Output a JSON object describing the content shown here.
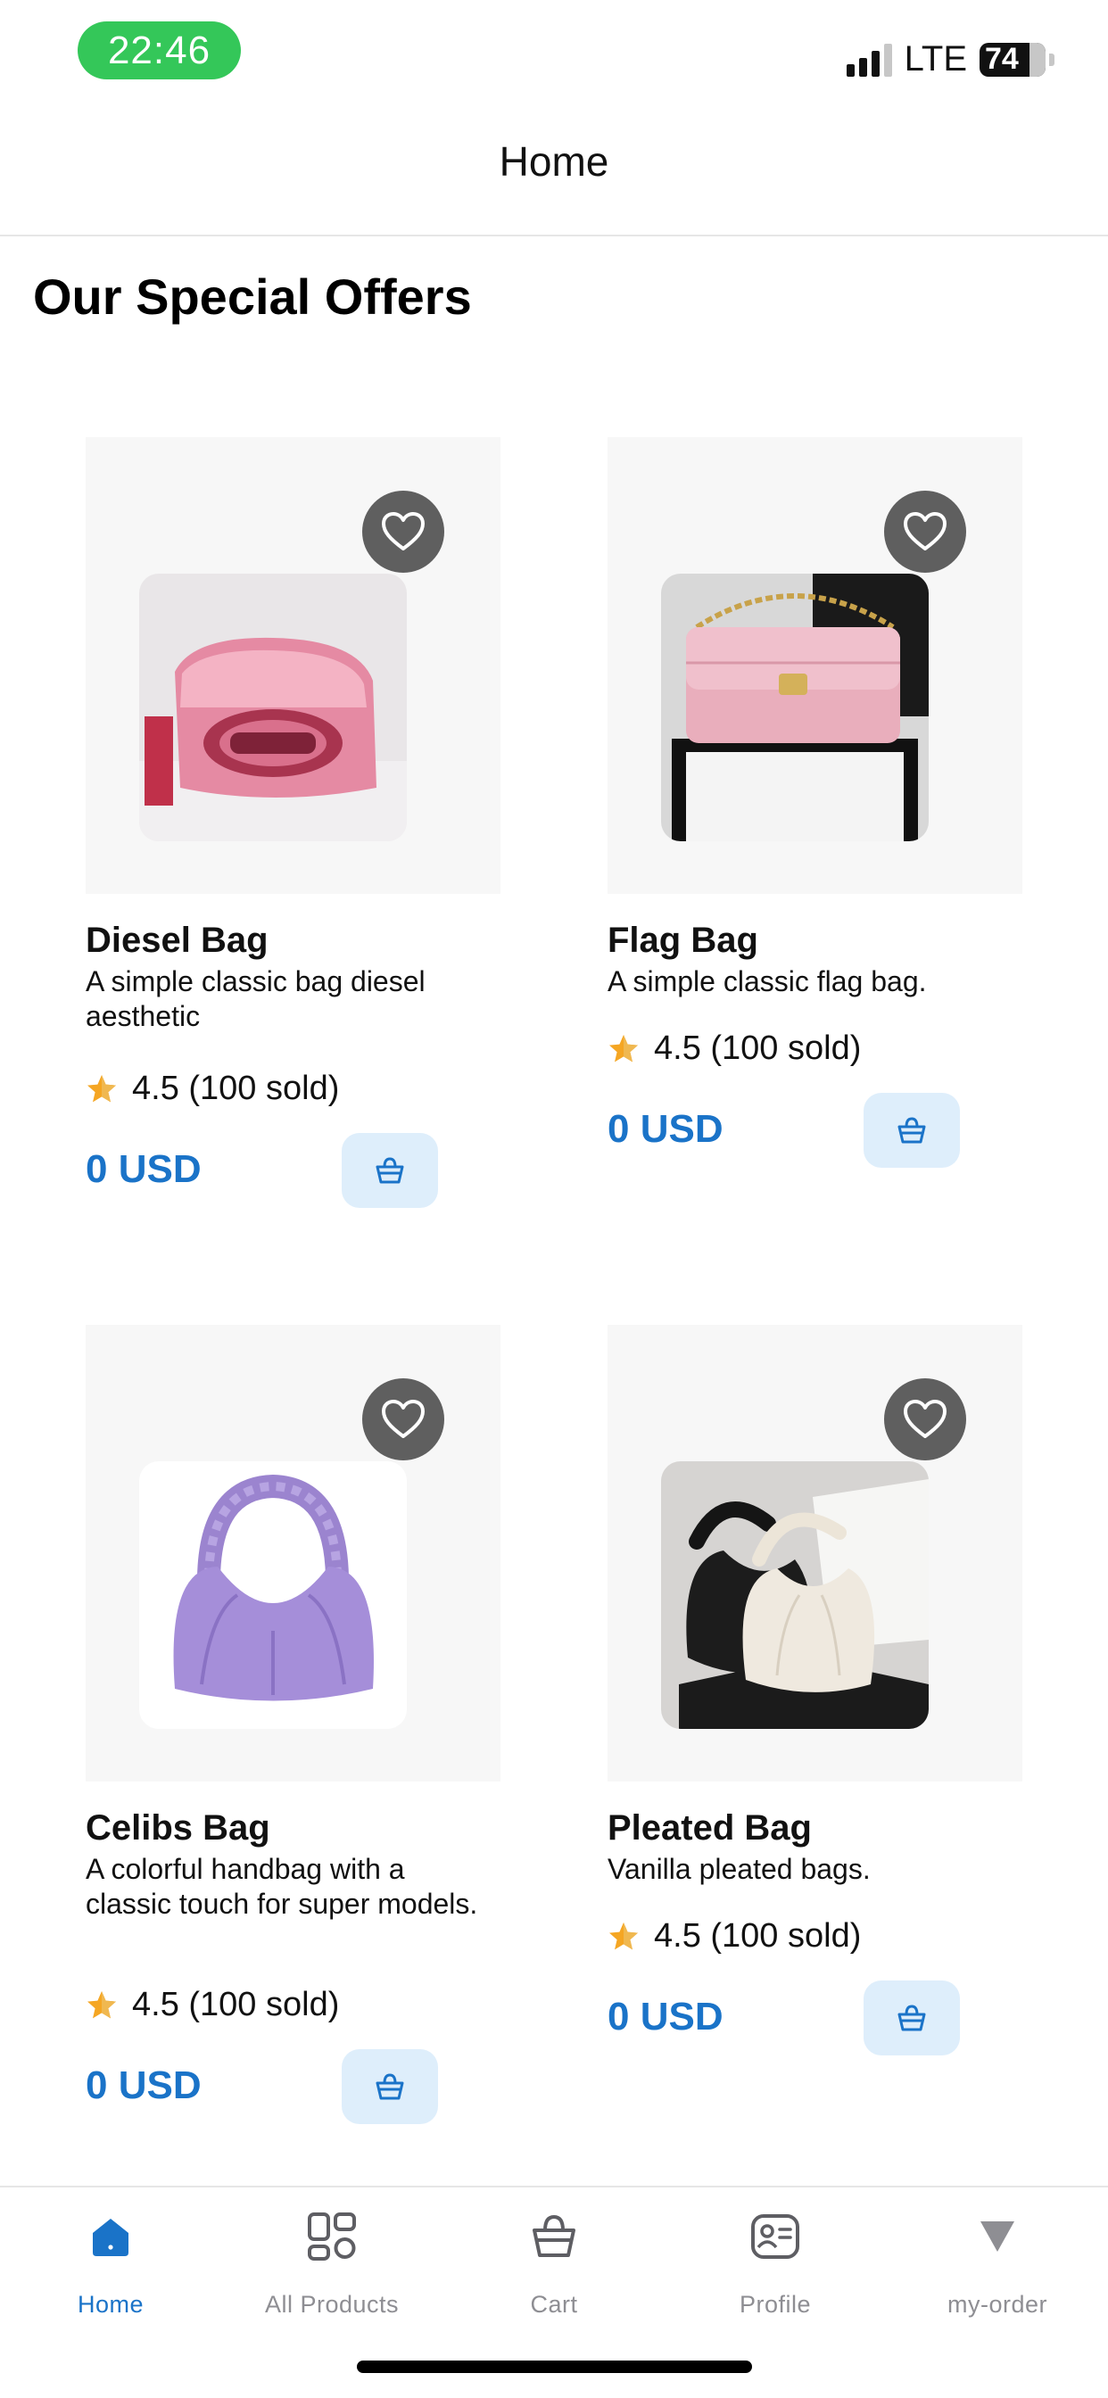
{
  "status_bar": {
    "time": "22:46",
    "network": "LTE",
    "battery": "74"
  },
  "header": {
    "title": "Home"
  },
  "section": {
    "title": "Our Special Offers"
  },
  "products": [
    {
      "name": "Diesel Bag",
      "description": "A simple classic bag diesel aesthetic",
      "rating": "4.5 (100 sold)",
      "price": "0 USD"
    },
    {
      "name": "Flag Bag",
      "description": "A simple classic flag bag.",
      "rating": "4.5 (100 sold)",
      "price": "0 USD"
    },
    {
      "name": "Celibs Bag",
      "description": "A colorful handbag with a classic touch for super models.",
      "rating": "4.5 (100 sold)",
      "price": "0 USD"
    },
    {
      "name": "Pleated Bag",
      "description": "Vanilla pleated bags.",
      "rating": "4.5 (100 sold)",
      "price": "0 USD"
    }
  ],
  "tabs": [
    {
      "label": "Home",
      "icon": "home-icon",
      "active": true
    },
    {
      "label": "All Products",
      "icon": "grid-icon",
      "active": false
    },
    {
      "label": "Cart",
      "icon": "basket-icon",
      "active": false
    },
    {
      "label": "Profile",
      "icon": "profile-card-icon",
      "active": false
    },
    {
      "label": "my-order",
      "icon": "triangle-down-icon",
      "active": false
    }
  ],
  "colors": {
    "accent": "#1a73c8",
    "status_pill": "#34c759",
    "rating_star": "#f5a623",
    "cart_button_bg": "#deeefb",
    "favorite_button_bg": "#5f5f5f"
  }
}
